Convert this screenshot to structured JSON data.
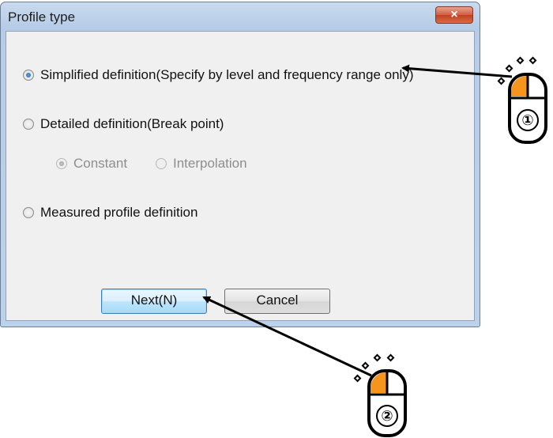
{
  "dialog": {
    "title": "Profile type",
    "close_symbol": "×"
  },
  "options": [
    {
      "label": "Simplified definition(Specify by level and frequency range only)",
      "selected": true,
      "enabled": true
    },
    {
      "label": "Detailed definition(Break point)",
      "selected": false,
      "enabled": true
    },
    {
      "label": "Measured profile definition",
      "selected": false,
      "enabled": true
    }
  ],
  "sub_options": [
    {
      "label": "Constant",
      "selected": true,
      "enabled": false
    },
    {
      "label": "Interpolation",
      "selected": false,
      "enabled": false
    }
  ],
  "buttons": {
    "next": "Next(N)",
    "cancel": "Cancel"
  },
  "annotations": [
    {
      "step": "①",
      "icon": "mouse-left-click-icon"
    },
    {
      "step": "②",
      "icon": "mouse-left-click-icon"
    }
  ],
  "colors": {
    "mouse_button": "#f7941d",
    "arrow": "#000000"
  }
}
